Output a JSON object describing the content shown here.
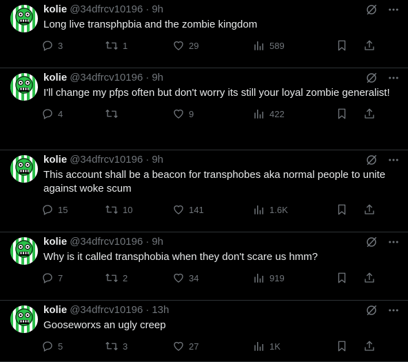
{
  "colors": {
    "background": "#000000",
    "text": "#e7e9ea",
    "muted": "#71767b",
    "border": "#2f3336",
    "avatar_green": "#2cbf4a"
  },
  "icons": {
    "reply": "reply-icon",
    "retweet": "retweet-icon",
    "like": "heart-icon",
    "views": "views-icon",
    "bookmark": "bookmark-icon",
    "share": "share-icon",
    "grok": "grok-icon",
    "more": "more-icon"
  },
  "tweets": [
    {
      "name": "kolie",
      "handle": "@34dfrcv10196",
      "time": "9h",
      "text": "Long live transphpbia and the zombie kingdom",
      "replies": "3",
      "retweets": "1",
      "likes": "29",
      "views": "589"
    },
    {
      "name": "kolie",
      "handle": "@34dfrcv10196",
      "time": "9h",
      "text": "I'll change my pfps often but don't worry its still your loyal zombie generalist!",
      "replies": "4",
      "retweets": "",
      "likes": "9",
      "views": "422"
    },
    {
      "name": "kolie",
      "handle": "@34dfrcv10196",
      "time": "9h",
      "text": "This account shall be a beacon for transphobes aka normal people to unite against woke scum",
      "replies": "15",
      "retweets": "10",
      "likes": "141",
      "views": "1.6K"
    },
    {
      "name": "kolie",
      "handle": "@34dfrcv10196",
      "time": "9h",
      "text": "Why is it called transphobia when  they don't scare us hmm?",
      "replies": "7",
      "retweets": "2",
      "likes": "34",
      "views": "919"
    },
    {
      "name": "kolie",
      "handle": "@34dfrcv10196",
      "time": "13h",
      "text": "Gooseworxs an ugly creep",
      "replies": "5",
      "retweets": "3",
      "likes": "27",
      "views": "1K"
    }
  ]
}
